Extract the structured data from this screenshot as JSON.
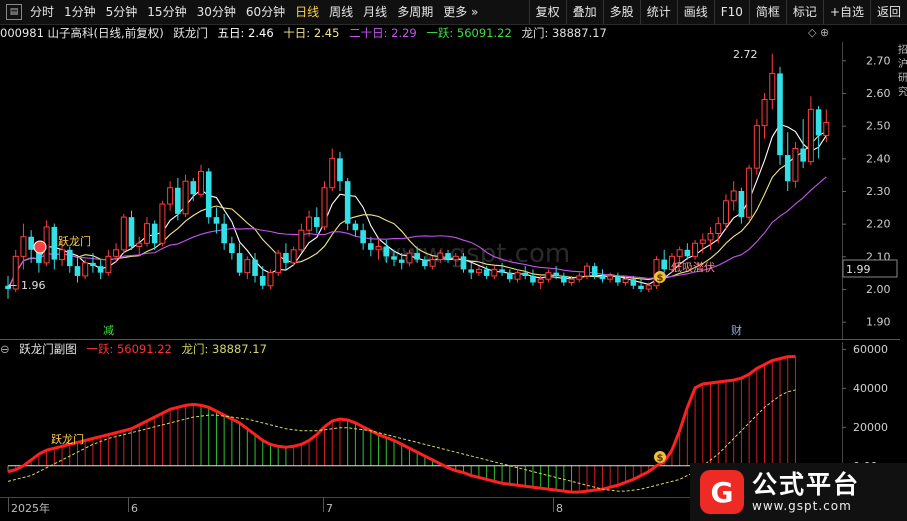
{
  "toolbar": {
    "periods": [
      "分时",
      "1分钟",
      "5分钟",
      "15分钟",
      "30分钟",
      "60分钟",
      "日线",
      "周线",
      "月线",
      "多周期",
      "更多 »"
    ],
    "active_period": "日线",
    "right_buttons": [
      "复权",
      "叠加",
      "多股",
      "统计",
      "画线",
      "F10",
      "简框",
      "标记",
      "+自选",
      "返回"
    ]
  },
  "info": {
    "stock": "000981 山子高科(日线,前复权)",
    "indicator": "跃龙门",
    "ma5_label": "五日: 2.46",
    "ma10_label": "十日: 2.45",
    "ma20_label": "二十日: 2.29",
    "yue_label": "一跃: 56091.22",
    "longmen_label": "龙门: 38887.17",
    "top_icons": "◇ ⊕"
  },
  "sub_info": {
    "title": "跃龙门副图",
    "yue_label": "一跃: 56091.22",
    "longmen_label": "龙门: 38887.17"
  },
  "colors": {
    "up": "#ff3d3d",
    "down": "#32e0e8",
    "ma5": "#ffffff",
    "ma10": "#f2e68a",
    "ma20": "#c455ee",
    "yue": "#ff2020",
    "longmen": "#d8d860",
    "text_orange": "#ffb400",
    "text_green": "#3fdf3f"
  },
  "main_axis": {
    "min": 1.85,
    "max": 2.75,
    "ticks": [
      "2.70",
      "2.60",
      "2.50",
      "2.40",
      "2.30",
      "2.20",
      "2.10",
      "2.00",
      "1.90"
    ],
    "current_price": "1.99"
  },
  "sub_axis": {
    "min": -15000,
    "max": 62000,
    "ticks": [
      "60000",
      "40000",
      "20000",
      "0.00"
    ]
  },
  "annotations": {
    "high_label": "2.72",
    "low_label": "1.96",
    "yue_longmen_main": "跃龙门",
    "dixi_label": "低吸潜伏",
    "jian_label": "减",
    "cai_label": "财",
    "yue_longmen_sub": "跃龙门",
    "money_glyph": "$"
  },
  "time_axis": {
    "labels": [
      "2025年",
      "6",
      "7",
      "8"
    ]
  },
  "right_edge_text": "招 沪 研 究",
  "badge": {
    "title": "公式平台",
    "url": "www.gspt.com"
  },
  "watermark": "www.gspt.com",
  "chart_data": {
    "type": "candlestick",
    "candles": [
      [
        2.01,
        2.04,
        1.97,
        2.0
      ],
      [
        2.0,
        2.12,
        1.99,
        2.1
      ],
      [
        2.1,
        2.2,
        2.06,
        2.16
      ],
      [
        2.16,
        2.18,
        2.08,
        2.12
      ],
      [
        2.12,
        2.14,
        2.05,
        2.08
      ],
      [
        2.08,
        2.21,
        2.07,
        2.19
      ],
      [
        2.19,
        2.2,
        2.06,
        2.09
      ],
      [
        2.09,
        2.15,
        2.07,
        2.12
      ],
      [
        2.12,
        2.13,
        2.05,
        2.07
      ],
      [
        2.07,
        2.1,
        2.02,
        2.04
      ],
      [
        2.04,
        2.09,
        2.03,
        2.08
      ],
      [
        2.08,
        2.11,
        2.05,
        2.07
      ],
      [
        2.07,
        2.09,
        2.03,
        2.05
      ],
      [
        2.05,
        2.12,
        2.04,
        2.1
      ],
      [
        2.1,
        2.14,
        2.08,
        2.12
      ],
      [
        2.12,
        2.23,
        2.11,
        2.22
      ],
      [
        2.22,
        2.24,
        2.12,
        2.13
      ],
      [
        2.13,
        2.16,
        2.1,
        2.14
      ],
      [
        2.14,
        2.22,
        2.13,
        2.2
      ],
      [
        2.2,
        2.21,
        2.12,
        2.14
      ],
      [
        2.14,
        2.27,
        2.13,
        2.26
      ],
      [
        2.26,
        2.33,
        2.24,
        2.31
      ],
      [
        2.31,
        2.34,
        2.21,
        2.23
      ],
      [
        2.23,
        2.35,
        2.22,
        2.33
      ],
      [
        2.33,
        2.34,
        2.27,
        2.29
      ],
      [
        2.29,
        2.38,
        2.28,
        2.36
      ],
      [
        2.36,
        2.37,
        2.2,
        2.22
      ],
      [
        2.22,
        2.25,
        2.17,
        2.2
      ],
      [
        2.2,
        2.23,
        2.12,
        2.14
      ],
      [
        2.14,
        2.16,
        2.09,
        2.11
      ],
      [
        2.11,
        2.14,
        2.04,
        2.05
      ],
      [
        2.05,
        2.1,
        2.03,
        2.09
      ],
      [
        2.09,
        2.11,
        2.02,
        2.04
      ],
      [
        2.04,
        2.07,
        2.0,
        2.01
      ],
      [
        2.01,
        2.06,
        2.0,
        2.05
      ],
      [
        2.05,
        2.12,
        2.04,
        2.11
      ],
      [
        2.11,
        2.14,
        2.06,
        2.08
      ],
      [
        2.08,
        2.13,
        2.07,
        2.12
      ],
      [
        2.12,
        2.2,
        2.11,
        2.18
      ],
      [
        2.18,
        2.24,
        2.16,
        2.22
      ],
      [
        2.22,
        2.25,
        2.17,
        2.19
      ],
      [
        2.19,
        2.33,
        2.18,
        2.31
      ],
      [
        2.31,
        2.43,
        2.3,
        2.4
      ],
      [
        2.4,
        2.42,
        2.3,
        2.33
      ],
      [
        2.33,
        2.34,
        2.18,
        2.2
      ],
      [
        2.2,
        2.21,
        2.16,
        2.18
      ],
      [
        2.18,
        2.2,
        2.12,
        2.14
      ],
      [
        2.14,
        2.16,
        2.1,
        2.12
      ],
      [
        2.12,
        2.15,
        2.09,
        2.13
      ],
      [
        2.13,
        2.15,
        2.08,
        2.1
      ],
      [
        2.1,
        2.12,
        2.07,
        2.09
      ],
      [
        2.09,
        2.11,
        2.06,
        2.08
      ],
      [
        2.08,
        2.12,
        2.07,
        2.11
      ],
      [
        2.11,
        2.13,
        2.08,
        2.09
      ],
      [
        2.09,
        2.1,
        2.06,
        2.07
      ],
      [
        2.07,
        2.1,
        2.06,
        2.09
      ],
      [
        2.09,
        2.12,
        2.08,
        2.11
      ],
      [
        2.11,
        2.12,
        2.08,
        2.09
      ],
      [
        2.09,
        2.11,
        2.07,
        2.1
      ],
      [
        2.1,
        2.11,
        2.05,
        2.06
      ],
      [
        2.06,
        2.08,
        2.03,
        2.05
      ],
      [
        2.05,
        2.07,
        2.04,
        2.06
      ],
      [
        2.06,
        2.07,
        2.03,
        2.04
      ],
      [
        2.04,
        2.07,
        2.03,
        2.06
      ],
      [
        2.06,
        2.08,
        2.04,
        2.05
      ],
      [
        2.05,
        2.06,
        2.02,
        2.03
      ],
      [
        2.03,
        2.06,
        2.02,
        2.05
      ],
      [
        2.05,
        2.07,
        2.03,
        2.04
      ],
      [
        2.04,
        2.06,
        2.01,
        2.02
      ],
      [
        2.02,
        2.04,
        2.0,
        2.03
      ],
      [
        2.03,
        2.06,
        2.02,
        2.05
      ],
      [
        2.05,
        2.07,
        2.03,
        2.04
      ],
      [
        2.04,
        2.05,
        2.01,
        2.02
      ],
      [
        2.02,
        2.04,
        2.01,
        2.03
      ],
      [
        2.03,
        2.05,
        2.02,
        2.04
      ],
      [
        2.04,
        2.08,
        2.03,
        2.07
      ],
      [
        2.07,
        2.08,
        2.03,
        2.04
      ],
      [
        2.04,
        2.06,
        2.02,
        2.03
      ],
      [
        2.03,
        2.05,
        2.02,
        2.04
      ],
      [
        2.04,
        2.05,
        2.01,
        2.02
      ],
      [
        2.02,
        2.04,
        2.01,
        2.03
      ],
      [
        2.03,
        2.04,
        2.0,
        2.01
      ],
      [
        2.01,
        2.03,
        1.99,
        2.0
      ],
      [
        2.0,
        2.02,
        1.99,
        2.01
      ],
      [
        2.01,
        2.1,
        2.0,
        2.09
      ],
      [
        2.09,
        2.12,
        2.05,
        2.06
      ],
      [
        2.06,
        2.11,
        2.05,
        2.1
      ],
      [
        2.1,
        2.13,
        2.07,
        2.12
      ],
      [
        2.12,
        2.14,
        2.09,
        2.1
      ],
      [
        2.1,
        2.15,
        2.09,
        2.14
      ],
      [
        2.14,
        2.17,
        2.11,
        2.15
      ],
      [
        2.15,
        2.19,
        2.12,
        2.17
      ],
      [
        2.17,
        2.22,
        2.14,
        2.2
      ],
      [
        2.2,
        2.29,
        2.18,
        2.27
      ],
      [
        2.27,
        2.33,
        2.24,
        2.3
      ],
      [
        2.3,
        2.31,
        2.2,
        2.22
      ],
      [
        2.22,
        2.38,
        2.21,
        2.37
      ],
      [
        2.37,
        2.52,
        2.35,
        2.5
      ],
      [
        2.5,
        2.6,
        2.46,
        2.58
      ],
      [
        2.58,
        2.72,
        2.55,
        2.66
      ],
      [
        2.66,
        2.68,
        2.38,
        2.41
      ],
      [
        2.41,
        2.48,
        2.3,
        2.33
      ],
      [
        2.33,
        2.45,
        2.31,
        2.43
      ],
      [
        2.43,
        2.52,
        2.37,
        2.39
      ],
      [
        2.39,
        2.59,
        2.38,
        2.55
      ],
      [
        2.55,
        2.56,
        2.4,
        2.47
      ],
      [
        2.47,
        2.55,
        2.45,
        2.51
      ]
    ],
    "yue_series": [
      -3000,
      -2000,
      0,
      3000,
      6000,
      8000,
      9000,
      10000,
      11000,
      12000,
      13000,
      14000,
      15000,
      16000,
      17000,
      18000,
      19000,
      21000,
      23000,
      25000,
      27000,
      29000,
      30000,
      31000,
      31500,
      31000,
      30000,
      28000,
      26000,
      24000,
      22000,
      19000,
      16000,
      13000,
      11000,
      10000,
      9500,
      10000,
      11000,
      13000,
      16000,
      20000,
      23000,
      24000,
      23500,
      22000,
      20000,
      18000,
      16000,
      14500,
      13000,
      11000,
      9000,
      7000,
      5000,
      3000,
      1000,
      -1000,
      -2500,
      -3500,
      -5000,
      -6000,
      -7000,
      -8000,
      -9000,
      -9500,
      -10000,
      -10500,
      -11000,
      -11500,
      -12000,
      -12500,
      -13000,
      -13500,
      -13500,
      -13000,
      -12500,
      -12000,
      -11000,
      -10000,
      -8500,
      -7000,
      -5000,
      -3000,
      0,
      2000,
      8000,
      18000,
      30000,
      40000,
      42000,
      42500,
      43000,
      43500,
      44000,
      45000,
      47000,
      50000,
      52000,
      54000,
      55000,
      56000,
      56091
    ],
    "longmen_series": [
      -8000,
      -7000,
      -6000,
      -5000,
      -3000,
      -1000,
      1000,
      3000,
      5000,
      7000,
      9000,
      11000,
      12500,
      14000,
      15000,
      16000,
      17000,
      18000,
      19000,
      20000,
      21000,
      22000,
      23000,
      24000,
      25000,
      25500,
      26000,
      26000,
      25500,
      25000,
      24500,
      24000,
      23000,
      22000,
      21000,
      20000,
      19000,
      18500,
      18000,
      18000,
      18000,
      18500,
      19000,
      19500,
      19500,
      19000,
      18500,
      18000,
      17000,
      16000,
      15000,
      14000,
      13000,
      12000,
      11000,
      10000,
      9000,
      8000,
      7000,
      6000,
      5000,
      4000,
      3000,
      2000,
      1000,
      0,
      -1000,
      -2000,
      -3000,
      -4000,
      -5000,
      -6000,
      -7000,
      -8000,
      -9000,
      -10000,
      -11000,
      -12000,
      -12500,
      -13000,
      -13000,
      -12500,
      -12000,
      -11000,
      -10000,
      -9000,
      -8000,
      -7000,
      -5000,
      -3000,
      0,
      3000,
      6000,
      10000,
      14000,
      18000,
      22000,
      26000,
      30000,
      33000,
      36000,
      38000,
      38887
    ]
  }
}
